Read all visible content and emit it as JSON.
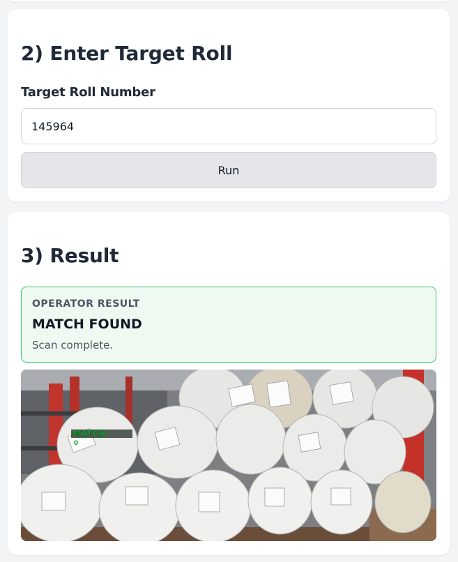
{
  "step2": {
    "title": "2) Enter Target Roll",
    "field_label": "Target Roll Number",
    "input_value": "145964",
    "run_label": "Run"
  },
  "step3": {
    "title": "3) Result",
    "result": {
      "eyebrow": "OPERATOR RESULT",
      "status": "MATCH FOUND",
      "detail": "Scan complete."
    },
    "photo": {
      "overlay_label": "MATCH",
      "overlay_sublabel": "0",
      "overlay_color": "#1fa83a"
    }
  },
  "colors": {
    "success_border": "#34c26a",
    "success_bg": "#eefaf1",
    "button_bg": "#e5e5ea"
  }
}
